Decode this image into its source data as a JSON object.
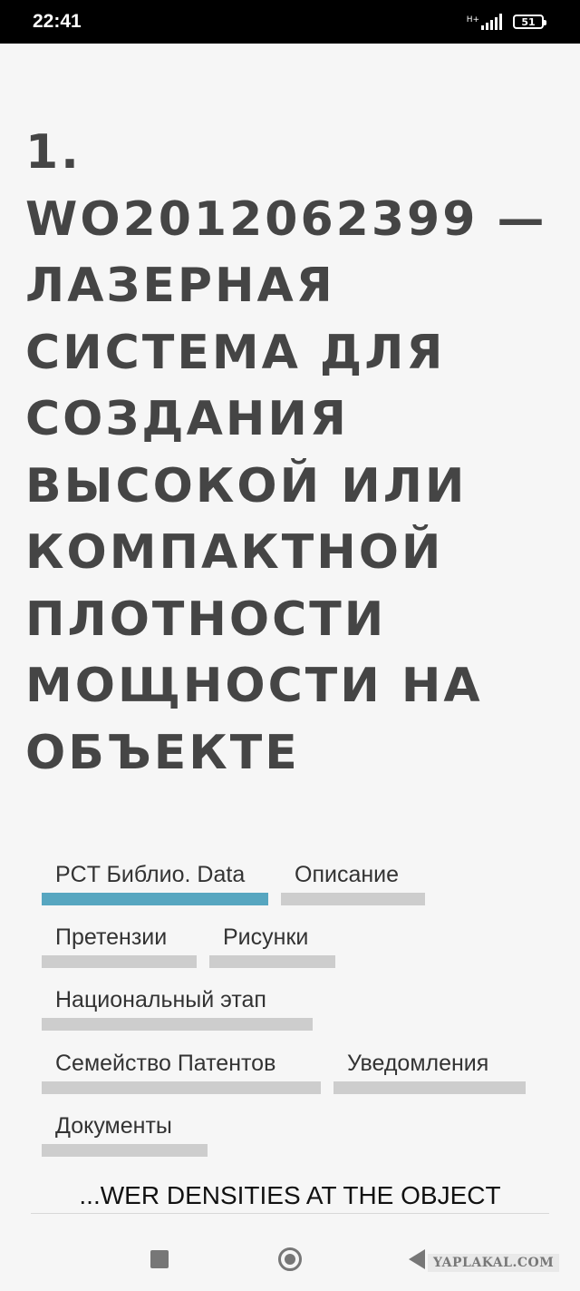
{
  "status_bar": {
    "time": "22:41",
    "network": "H+",
    "battery": "51"
  },
  "title": "1. WO2012062399 — ЛАЗЕРНАЯ СИСТЕМА ДЛЯ СОЗДАНИЯ ВЫСОКОЙ ИЛИ КОМПАКТНОЙ ПЛОТНОСТИ МОЩНОСТИ НА ОБЪЕКТЕ",
  "tabs": [
    {
      "label": "PCT Библио. Data",
      "active": true
    },
    {
      "label": "Описание",
      "active": false
    },
    {
      "label": "Претензии",
      "active": false
    },
    {
      "label": "Рисунки",
      "active": false
    },
    {
      "label": "Национальный этап",
      "active": false
    },
    {
      "label": "Семейство Патентов",
      "active": false
    },
    {
      "label": "Уведомления",
      "active": false
    },
    {
      "label": "Документы",
      "active": false
    }
  ],
  "translation_text": "...WER DENSITIES AT THE OBJECT",
  "watermark": "YAPLAKAL.COM",
  "colors": {
    "active_tab": "#57a6c0",
    "inactive_tab": "#cdcdcd",
    "title": "#454545"
  }
}
